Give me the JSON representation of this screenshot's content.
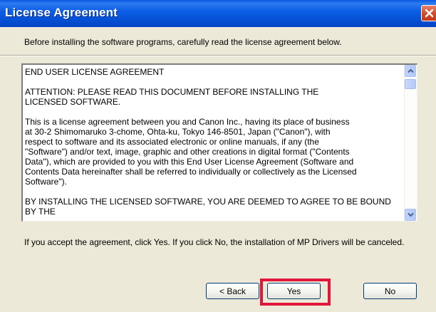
{
  "window": {
    "title": "License Agreement",
    "close_icon": "close-icon"
  },
  "instruction": "Before installing the software programs, carefully read the license agreement below.",
  "license": {
    "paragraphs": [
      "END USER LICENSE AGREEMENT",
      "ATTENTION: PLEASE READ THIS DOCUMENT BEFORE INSTALLING THE\nLICENSED SOFTWARE.",
      "This is a license agreement between you and Canon Inc., having its place of business\nat 30-2 Shimomaruko 3-chome, Ohta-ku, Tokyo 146-8501, Japan (\"Canon\"), with\nrespect to software and its associated electronic or online manuals, if any (the\n\"Software\") and/or text, image, graphic and other creations in digital format (\"Contents\nData\"), which are provided to you with this End User License Agreement (Software and\nContents Data hereinafter shall be referred to individually or collectively as the Licensed\nSoftware\").",
      "BY INSTALLING THE LICENSED SOFTWARE, YOU ARE DEEMED TO AGREE TO BE BOUND BY THE"
    ],
    "scroll_up_icon": "chevron-up-icon",
    "scroll_down_icon": "chevron-down-icon"
  },
  "footer_text": "If you accept the agreement, click Yes. If you click No, the installation of MP Drivers will be canceled.",
  "buttons": {
    "back": "< Back",
    "yes": "Yes",
    "no": "No"
  },
  "colors": {
    "titlebar": "#0651d6",
    "dialog_bg": "#ece9d8",
    "highlight": "#e2163a"
  }
}
